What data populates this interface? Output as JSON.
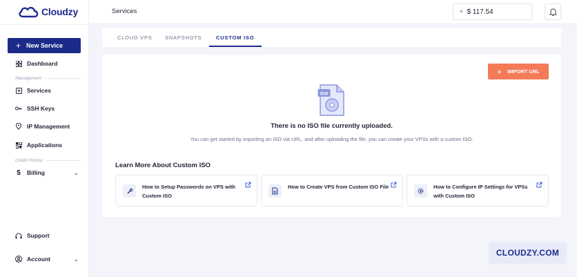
{
  "brand": {
    "name": "Cloudzy"
  },
  "sidebar": {
    "new_service": "New Service",
    "items": [
      {
        "label": "Dashboard",
        "icon": "grid-icon"
      },
      {
        "label": "Services",
        "icon": "plus-square-icon"
      },
      {
        "label": "SSH Keys",
        "icon": "key-icon"
      },
      {
        "label": "IP Management",
        "icon": "location-pin-icon"
      },
      {
        "label": "Applications",
        "icon": "apps-icon"
      },
      {
        "label": "Billing",
        "icon": "dollar-icon"
      },
      {
        "label": "Support",
        "icon": "headset-icon"
      },
      {
        "label": "Account",
        "icon": "user-circle-icon"
      }
    ],
    "sections": {
      "management": "Management",
      "credit_history": "Credit History"
    }
  },
  "header": {
    "title": "Services",
    "balance": "$ 117.54"
  },
  "tabs": [
    {
      "label": "CLOUD VPS"
    },
    {
      "label": "SNAPSHOTS"
    },
    {
      "label": "CUSTOM ISO",
      "active": true
    }
  ],
  "main": {
    "import_button": "IMPORT URL",
    "iso_badge": "ISO",
    "empty_title": "There is no ISO file currently uploaded.",
    "empty_subtitle": "You can get started by importing an ISO via URL, and after uploading the file, you can create your VPSs with a custom ISO.",
    "learn_title": "Learn More About Custom ISO",
    "help_cards": [
      {
        "text": "How to Setup Passwords on VPS with Custom ISO",
        "icon": "key-icon"
      },
      {
        "text": "How to Create VPS from Custom ISO File",
        "icon": "file-icon"
      },
      {
        "text": "How to Configure IP Settings for VPSs with Custom ISO",
        "icon": "gear-icon"
      }
    ]
  },
  "watermark": "CLOUDZY.COM",
  "colors": {
    "primary": "#1c2b8a",
    "accent": "#f47a58",
    "background": "#f4f5fb"
  }
}
